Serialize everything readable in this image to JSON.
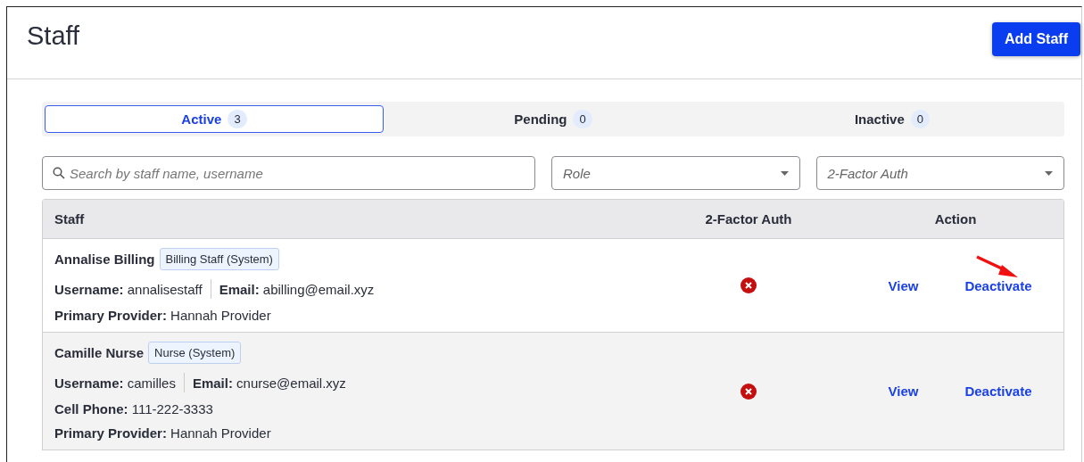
{
  "page": {
    "title": "Staff",
    "add_button": "Add Staff"
  },
  "tabs": [
    {
      "label": "Active",
      "count": "3",
      "selected": true
    },
    {
      "label": "Pending",
      "count": "0",
      "selected": false
    },
    {
      "label": "Inactive",
      "count": "0",
      "selected": false
    }
  ],
  "filters": {
    "search": {
      "placeholder": "Search by staff name, username"
    },
    "role": {
      "placeholder": "Role"
    },
    "two_factor": {
      "placeholder": "2-Factor Auth"
    }
  },
  "table": {
    "columns": [
      "Staff",
      "2-Factor Auth",
      "Action"
    ],
    "rows": [
      {
        "name": "Annalise Billing",
        "role": "Billing Staff (System)",
        "highlighted": false,
        "two_factor_enabled": false,
        "pointer_arrow": true,
        "lines": [
          [
            {
              "label": "Username:",
              "value": "annalisestaff"
            },
            {
              "label": "Email:",
              "value": "abilling@email.xyz"
            }
          ],
          [
            {
              "label": "Primary Provider:",
              "value": "Hannah Provider"
            }
          ]
        ],
        "actions": [
          "View",
          "Deactivate"
        ]
      },
      {
        "name": "Camille Nurse",
        "role": "Nurse (System)",
        "highlighted": true,
        "two_factor_enabled": false,
        "pointer_arrow": false,
        "lines": [
          [
            {
              "label": "Username:",
              "value": "camilles"
            },
            {
              "label": "Email:",
              "value": "cnurse@email.xyz"
            }
          ],
          [
            {
              "label": "Cell Phone:",
              "value": "111-222-3333"
            }
          ],
          [
            {
              "label": "Primary Provider:",
              "value": "Hannah Provider"
            }
          ]
        ],
        "actions": [
          "View",
          "Deactivate"
        ]
      }
    ]
  }
}
